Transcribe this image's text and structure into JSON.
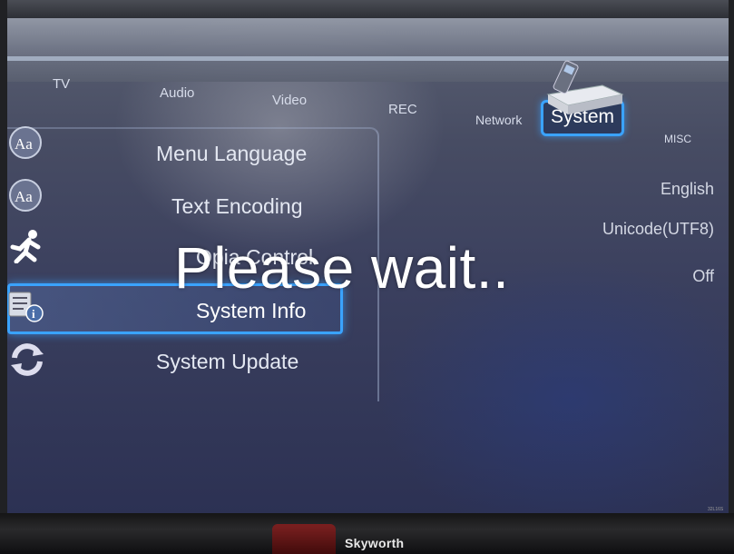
{
  "tabs": [
    {
      "label": "TV"
    },
    {
      "label": "Audio"
    },
    {
      "label": "Video"
    },
    {
      "label": "REC"
    },
    {
      "label": "Network"
    },
    {
      "label": "System"
    },
    {
      "label": "MISC"
    }
  ],
  "active_tab": "System",
  "menu": {
    "items": [
      {
        "label": "Menu Language",
        "icon": "language-icon",
        "value": "English"
      },
      {
        "label": "Text Encoding",
        "icon": "language-icon",
        "value": "Unicode(UTF8)"
      },
      {
        "label": "Opia Control",
        "icon": "running-man-icon",
        "value": "Off"
      },
      {
        "label": "System Info",
        "icon": "info-icon",
        "value": ""
      },
      {
        "label": "System Update",
        "icon": "update-icon",
        "value": ""
      }
    ],
    "selected": "System Info"
  },
  "overlay": {
    "message": "Please wait.."
  },
  "brand": {
    "name": "Skyworth",
    "model": "32L16S"
  },
  "colors": {
    "accent": "#3aa3ff",
    "screen_bg": "#3a3f5e"
  }
}
